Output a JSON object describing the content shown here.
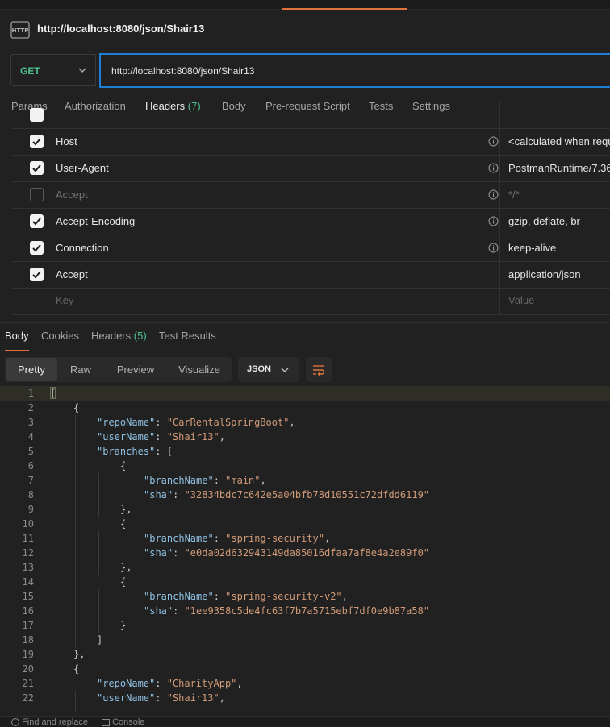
{
  "title": "http://localhost:8080/json/Shair13",
  "request": {
    "method": "GET",
    "url": "http://localhost:8080/json/Shair13"
  },
  "request_tabs": [
    {
      "label": "Params",
      "count": ""
    },
    {
      "label": "Authorization",
      "count": ""
    },
    {
      "label": "Headers",
      "count": "(7)"
    },
    {
      "label": "Body",
      "count": ""
    },
    {
      "label": "Pre-request Script",
      "count": ""
    },
    {
      "label": "Tests",
      "count": ""
    },
    {
      "label": "Settings",
      "count": ""
    }
  ],
  "headers": [
    {
      "checked": true,
      "key": "Host",
      "value": "<calculated when requ",
      "info": true
    },
    {
      "checked": true,
      "key": "User-Agent",
      "value": "PostmanRuntime/7.36.",
      "info": true
    },
    {
      "checked": false,
      "key": "Accept",
      "value": "*/*",
      "info": true
    },
    {
      "checked": true,
      "key": "Accept-Encoding",
      "value": "gzip, deflate, br",
      "info": true
    },
    {
      "checked": true,
      "key": "Connection",
      "value": "keep-alive",
      "info": true
    },
    {
      "checked": true,
      "key": "Accept",
      "value": "application/json",
      "info": false
    }
  ],
  "new_header": {
    "key_placeholder": "Key",
    "value_placeholder": "Value"
  },
  "response_tabs": [
    {
      "label": "Body",
      "count": ""
    },
    {
      "label": "Cookies",
      "count": ""
    },
    {
      "label": "Headers",
      "count": "(5)"
    },
    {
      "label": "Test Results",
      "count": ""
    }
  ],
  "view_modes": [
    "Pretty",
    "Raw",
    "Preview",
    "Visualize"
  ],
  "format": "JSON",
  "code_lines": [
    {
      "n": "1",
      "indent": 0,
      "parts": [
        [
          "p",
          "["
        ]
      ]
    },
    {
      "n": "2",
      "indent": 1,
      "parts": [
        [
          "p",
          "{"
        ]
      ]
    },
    {
      "n": "3",
      "indent": 2,
      "parts": [
        [
          "k",
          "\"repoName\""
        ],
        [
          "p",
          ": "
        ],
        [
          "s",
          "\"CarRentalSpringBoot\""
        ],
        [
          "p",
          ","
        ]
      ]
    },
    {
      "n": "4",
      "indent": 2,
      "parts": [
        [
          "k",
          "\"userName\""
        ],
        [
          "p",
          ": "
        ],
        [
          "s",
          "\"Shair13\""
        ],
        [
          "p",
          ","
        ]
      ]
    },
    {
      "n": "5",
      "indent": 2,
      "parts": [
        [
          "k",
          "\"branches\""
        ],
        [
          "p",
          ": ["
        ]
      ]
    },
    {
      "n": "6",
      "indent": 3,
      "parts": [
        [
          "p",
          "{"
        ]
      ]
    },
    {
      "n": "7",
      "indent": 4,
      "parts": [
        [
          "k",
          "\"branchName\""
        ],
        [
          "p",
          ": "
        ],
        [
          "s",
          "\"main\""
        ],
        [
          "p",
          ","
        ]
      ]
    },
    {
      "n": "8",
      "indent": 4,
      "parts": [
        [
          "k",
          "\"sha\""
        ],
        [
          "p",
          ": "
        ],
        [
          "s",
          "\"32834bdc7c642e5a04bfb78d10551c72dfdd6119\""
        ]
      ]
    },
    {
      "n": "9",
      "indent": 3,
      "parts": [
        [
          "p",
          "},"
        ]
      ]
    },
    {
      "n": "10",
      "indent": 3,
      "parts": [
        [
          "p",
          "{"
        ]
      ]
    },
    {
      "n": "11",
      "indent": 4,
      "parts": [
        [
          "k",
          "\"branchName\""
        ],
        [
          "p",
          ": "
        ],
        [
          "s",
          "\"spring-security\""
        ],
        [
          "p",
          ","
        ]
      ]
    },
    {
      "n": "12",
      "indent": 4,
      "parts": [
        [
          "k",
          "\"sha\""
        ],
        [
          "p",
          ": "
        ],
        [
          "s",
          "\"e0da02d632943149da85016dfaa7af8e4a2e89f0\""
        ]
      ]
    },
    {
      "n": "13",
      "indent": 3,
      "parts": [
        [
          "p",
          "},"
        ]
      ]
    },
    {
      "n": "14",
      "indent": 3,
      "parts": [
        [
          "p",
          "{"
        ]
      ]
    },
    {
      "n": "15",
      "indent": 4,
      "parts": [
        [
          "k",
          "\"branchName\""
        ],
        [
          "p",
          ": "
        ],
        [
          "s",
          "\"spring-security-v2\""
        ],
        [
          "p",
          ","
        ]
      ]
    },
    {
      "n": "16",
      "indent": 4,
      "parts": [
        [
          "k",
          "\"sha\""
        ],
        [
          "p",
          ": "
        ],
        [
          "s",
          "\"1ee9358c5de4fc63f7b7a5715ebf7df0e9b87a58\""
        ]
      ]
    },
    {
      "n": "17",
      "indent": 3,
      "parts": [
        [
          "p",
          "}"
        ]
      ]
    },
    {
      "n": "18",
      "indent": 2,
      "parts": [
        [
          "p",
          "]"
        ]
      ]
    },
    {
      "n": "19",
      "indent": 1,
      "parts": [
        [
          "p",
          "},"
        ]
      ]
    },
    {
      "n": "20",
      "indent": 1,
      "parts": [
        [
          "p",
          "{"
        ]
      ]
    },
    {
      "n": "21",
      "indent": 2,
      "parts": [
        [
          "k",
          "\"repoName\""
        ],
        [
          "p",
          ": "
        ],
        [
          "s",
          "\"CharityApp\""
        ],
        [
          "p",
          ","
        ]
      ]
    },
    {
      "n": "22",
      "indent": 2,
      "parts": [
        [
          "k",
          "\"userName\""
        ],
        [
          "p",
          ": "
        ],
        [
          "s",
          "\"Shair13\""
        ],
        [
          "p",
          ","
        ]
      ]
    }
  ],
  "status_bar": {
    "find_replace": "Find and replace",
    "console": "Console"
  },
  "colors": {
    "accent": "#e0733a",
    "method_get": "#4fc08d",
    "focus_border": "#1e7fd8",
    "json_key": "#8fc1e3",
    "json_string": "#d19a78"
  }
}
